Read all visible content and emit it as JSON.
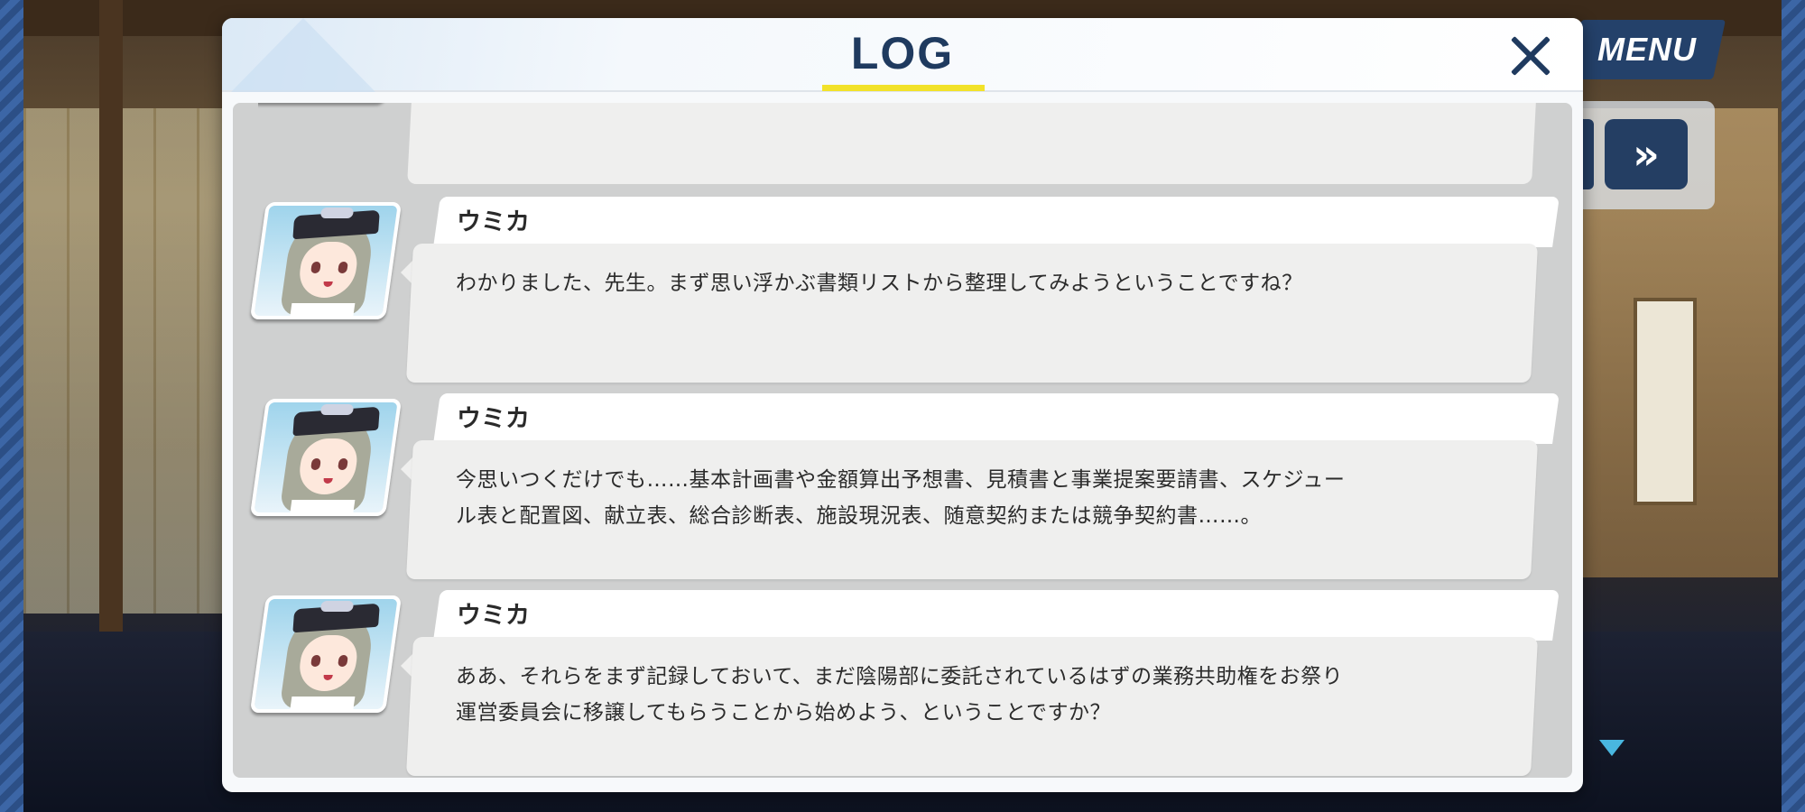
{
  "header": {
    "title": "LOG",
    "menu_label": "MENU",
    "fast_forward_label": "»"
  },
  "colors": {
    "title_text": "#1f3a5f",
    "title_underline": "#f2e22a",
    "menu_bg": "#24416a",
    "log_bg": "#cfd0d0",
    "bubble_bg": "#efefee"
  },
  "icons": {
    "close": "close-icon",
    "fast_forward": "fast-forward-icon",
    "scroll_down": "triangle-down-icon"
  },
  "log": {
    "entries": [
      {
        "speaker": "ウミカ",
        "lines": [
          "わかりました、先生。まず思い浮かぶ書類リストから整理してみようということですね？"
        ]
      },
      {
        "speaker": "ウミカ",
        "lines": [
          "今思いつくだけでも……基本計画書や金額算出予想書、見積書と事業提案要請書、スケジュー",
          "ル表と配置図、献立表、総合診断表、施設現況表、随意契約または競争契約書……。"
        ]
      },
      {
        "speaker": "ウミカ",
        "lines": [
          "ああ、それらをまず記録しておいて、まだ陰陽部に委託されているはずの業務共助権をお祭り",
          "運営委員会に移譲してもらうことから始めよう、ということですか？"
        ]
      }
    ]
  }
}
